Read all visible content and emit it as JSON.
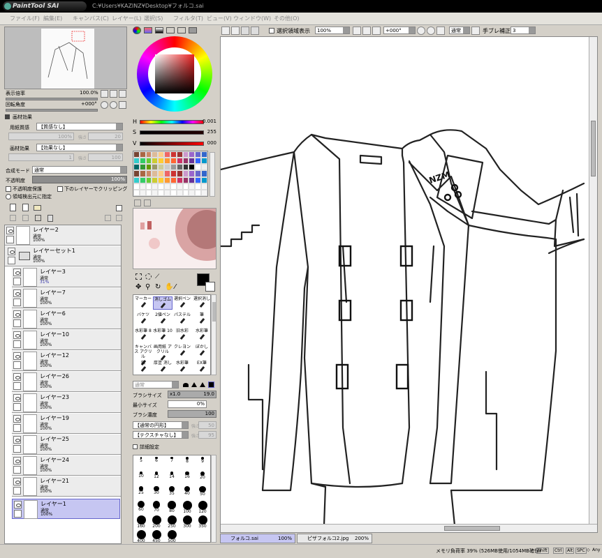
{
  "app": {
    "logo": "PaintTool SAI",
    "path": "C:¥Users¥KAZINZ¥Desktop¥フォルコ.sai"
  },
  "menu": [
    "ファイル(F)",
    "編集(E)",
    "キャンバス(C)",
    "レイヤー(L)",
    "選択(S)",
    "フィルタ(T)",
    "ビュー(V)",
    "ウィンドウ(W)",
    "その他(O)"
  ],
  "navigator": {
    "zoom_label": "表示倍率",
    "zoom_value": "100.0%",
    "rotate_label": "回転角度",
    "rotate_value": "+000°"
  },
  "texture": {
    "section": "画材効果",
    "paper_label": "用紙質感",
    "paper_value": "【質感なし】",
    "paper_scale_value": "100%",
    "paper_strength_label": "強さ",
    "paper_strength_value": "20",
    "effect_label": "画材効果",
    "effect_value": "【効果なし】",
    "effect_width_value": "1",
    "effect_strength_label": "強さ",
    "effect_strength_value": "100"
  },
  "blend": {
    "label": "合成モード",
    "value": "通常",
    "opacity_label": "不透明度",
    "opacity_value": "100%",
    "protect_label": "不透明度保護",
    "clip_label": "下のレイヤーでクリッピング",
    "select_label": "領域検出元に指定"
  },
  "layers": [
    {
      "name": "レイヤー2",
      "mode": "通常",
      "opacity": "100%",
      "selected": false
    },
    {
      "name": "レイヤーセット1",
      "mode": "通常",
      "opacity": "100%",
      "selected": false
    },
    {
      "name": "レイヤー3",
      "mode": "通常",
      "opacity": "31%",
      "selected": false
    },
    {
      "name": "レイヤー7",
      "mode": "通常",
      "opacity": "100%",
      "selected": false
    },
    {
      "name": "レイヤー6",
      "mode": "通常",
      "opacity": "100%",
      "selected": false
    },
    {
      "name": "レイヤー10",
      "mode": "通常",
      "opacity": "100%",
      "selected": false
    },
    {
      "name": "レイヤー12",
      "mode": "通常",
      "opacity": "100%",
      "selected": false
    },
    {
      "name": "レイヤー26",
      "mode": "通常",
      "opacity": "100%",
      "selected": false
    },
    {
      "name": "レイヤー23",
      "mode": "通常",
      "opacity": "100%",
      "selected": false
    },
    {
      "name": "レイヤー19",
      "mode": "通常",
      "opacity": "100%",
      "selected": false
    },
    {
      "name": "レイヤー25",
      "mode": "通常",
      "opacity": "100%",
      "selected": false
    },
    {
      "name": "レイヤー24",
      "mode": "通常",
      "opacity": "100%",
      "selected": false
    },
    {
      "name": "レイヤー21",
      "mode": "通常",
      "opacity": "100%",
      "selected": false
    },
    {
      "name": "レイヤー1",
      "mode": "通常",
      "opacity": "100%",
      "selected": true
    }
  ],
  "color": {
    "h_label": "H",
    "h_value": "0.001",
    "s_label": "S",
    "s_value": "255",
    "v_label": "V",
    "v_value": "000"
  },
  "brushes": [
    [
      "マーカー",
      "消しゴム",
      "選択ペン",
      "選択消し"
    ],
    [
      "バケツ",
      "2値ペン",
      "パステル",
      "筆"
    ],
    [
      "水彩筆 8",
      "水彩筆 10",
      "旧水彩",
      "水彩筆"
    ],
    [
      "キャンバス アクリル",
      "画用紙 アクリル",
      "クレヨン",
      "ぼかし"
    ],
    [
      "鉛",
      "厚塗 消し",
      "水彩筆",
      "EX筆"
    ]
  ],
  "brush": {
    "mode": "通常",
    "size_label": "ブラシサイズ",
    "size_mult": "x1.0",
    "size_value": "19.0",
    "min_label": "最小サイズ",
    "min_value": "0%",
    "density_label": "ブラシ濃度",
    "density_value": "100",
    "shape_value": "【通常の円形】",
    "shape_strength_label": "強さ",
    "shape_strength_value": "50",
    "texture_value": "【テクスチャなし】",
    "texture_strength_label": "強さ",
    "texture_strength_value": "95",
    "detail_label": "詳細設定"
  },
  "dot_sizes": [
    "5",
    "6",
    "7",
    "8",
    "9",
    "10",
    "12",
    "14",
    "16",
    "20",
    "25",
    "30",
    "35",
    "40",
    "50",
    "60",
    "70",
    "80",
    "100",
    "120",
    "160",
    "200",
    "250",
    "300",
    "350",
    "400",
    "450",
    "500"
  ],
  "canvas_toolbar": {
    "select_show_label": "選択領域表示",
    "zoom_value": "100%",
    "angle_value": "+000°",
    "mode_value": "通常",
    "stabilizer_label": "手ブレ補正",
    "stabilizer_value": "3"
  },
  "tabs": [
    {
      "name": "フォルコ.sai",
      "zoom": "100%"
    },
    {
      "name": "ピザフォルコ2.jpg",
      "zoom": "200%"
    }
  ],
  "status": {
    "memory": "メモリ負荷率 39% (526MB使用/1054MB確保)",
    "keys": [
      "Shift",
      "Ctrl",
      "Alt",
      "SPC",
      "◇",
      "Any"
    ]
  },
  "accent": "#6666cc"
}
